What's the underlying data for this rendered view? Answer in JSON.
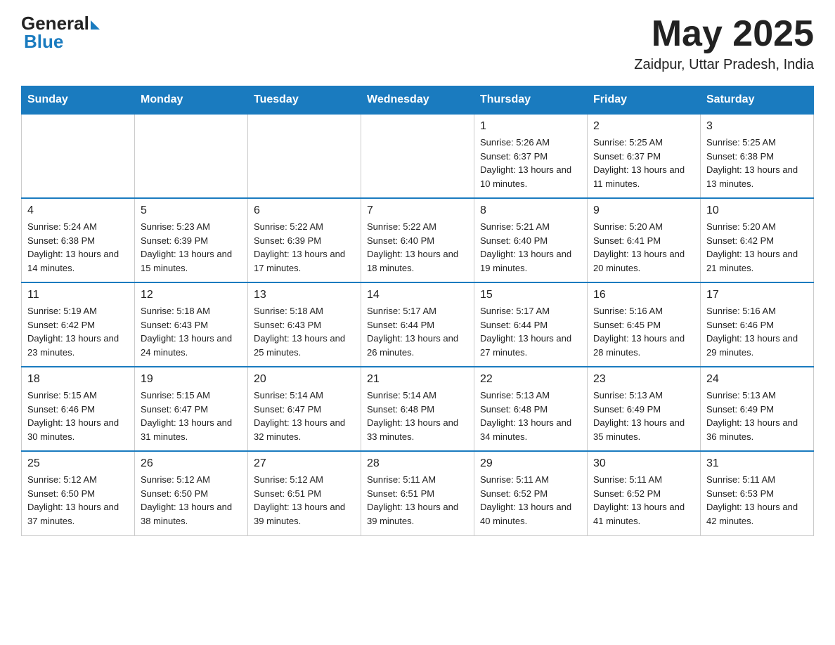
{
  "header": {
    "logo_general": "General",
    "logo_blue": "Blue",
    "month_title": "May 2025",
    "location": "Zaidpur, Uttar Pradesh, India"
  },
  "days_of_week": [
    "Sunday",
    "Monday",
    "Tuesday",
    "Wednesday",
    "Thursday",
    "Friday",
    "Saturday"
  ],
  "weeks": [
    [
      {
        "day": "",
        "info": ""
      },
      {
        "day": "",
        "info": ""
      },
      {
        "day": "",
        "info": ""
      },
      {
        "day": "",
        "info": ""
      },
      {
        "day": "1",
        "info": "Sunrise: 5:26 AM\nSunset: 6:37 PM\nDaylight: 13 hours and 10 minutes."
      },
      {
        "day": "2",
        "info": "Sunrise: 5:25 AM\nSunset: 6:37 PM\nDaylight: 13 hours and 11 minutes."
      },
      {
        "day": "3",
        "info": "Sunrise: 5:25 AM\nSunset: 6:38 PM\nDaylight: 13 hours and 13 minutes."
      }
    ],
    [
      {
        "day": "4",
        "info": "Sunrise: 5:24 AM\nSunset: 6:38 PM\nDaylight: 13 hours and 14 minutes."
      },
      {
        "day": "5",
        "info": "Sunrise: 5:23 AM\nSunset: 6:39 PM\nDaylight: 13 hours and 15 minutes."
      },
      {
        "day": "6",
        "info": "Sunrise: 5:22 AM\nSunset: 6:39 PM\nDaylight: 13 hours and 17 minutes."
      },
      {
        "day": "7",
        "info": "Sunrise: 5:22 AM\nSunset: 6:40 PM\nDaylight: 13 hours and 18 minutes."
      },
      {
        "day": "8",
        "info": "Sunrise: 5:21 AM\nSunset: 6:40 PM\nDaylight: 13 hours and 19 minutes."
      },
      {
        "day": "9",
        "info": "Sunrise: 5:20 AM\nSunset: 6:41 PM\nDaylight: 13 hours and 20 minutes."
      },
      {
        "day": "10",
        "info": "Sunrise: 5:20 AM\nSunset: 6:42 PM\nDaylight: 13 hours and 21 minutes."
      }
    ],
    [
      {
        "day": "11",
        "info": "Sunrise: 5:19 AM\nSunset: 6:42 PM\nDaylight: 13 hours and 23 minutes."
      },
      {
        "day": "12",
        "info": "Sunrise: 5:18 AM\nSunset: 6:43 PM\nDaylight: 13 hours and 24 minutes."
      },
      {
        "day": "13",
        "info": "Sunrise: 5:18 AM\nSunset: 6:43 PM\nDaylight: 13 hours and 25 minutes."
      },
      {
        "day": "14",
        "info": "Sunrise: 5:17 AM\nSunset: 6:44 PM\nDaylight: 13 hours and 26 minutes."
      },
      {
        "day": "15",
        "info": "Sunrise: 5:17 AM\nSunset: 6:44 PM\nDaylight: 13 hours and 27 minutes."
      },
      {
        "day": "16",
        "info": "Sunrise: 5:16 AM\nSunset: 6:45 PM\nDaylight: 13 hours and 28 minutes."
      },
      {
        "day": "17",
        "info": "Sunrise: 5:16 AM\nSunset: 6:46 PM\nDaylight: 13 hours and 29 minutes."
      }
    ],
    [
      {
        "day": "18",
        "info": "Sunrise: 5:15 AM\nSunset: 6:46 PM\nDaylight: 13 hours and 30 minutes."
      },
      {
        "day": "19",
        "info": "Sunrise: 5:15 AM\nSunset: 6:47 PM\nDaylight: 13 hours and 31 minutes."
      },
      {
        "day": "20",
        "info": "Sunrise: 5:14 AM\nSunset: 6:47 PM\nDaylight: 13 hours and 32 minutes."
      },
      {
        "day": "21",
        "info": "Sunrise: 5:14 AM\nSunset: 6:48 PM\nDaylight: 13 hours and 33 minutes."
      },
      {
        "day": "22",
        "info": "Sunrise: 5:13 AM\nSunset: 6:48 PM\nDaylight: 13 hours and 34 minutes."
      },
      {
        "day": "23",
        "info": "Sunrise: 5:13 AM\nSunset: 6:49 PM\nDaylight: 13 hours and 35 minutes."
      },
      {
        "day": "24",
        "info": "Sunrise: 5:13 AM\nSunset: 6:49 PM\nDaylight: 13 hours and 36 minutes."
      }
    ],
    [
      {
        "day": "25",
        "info": "Sunrise: 5:12 AM\nSunset: 6:50 PM\nDaylight: 13 hours and 37 minutes."
      },
      {
        "day": "26",
        "info": "Sunrise: 5:12 AM\nSunset: 6:50 PM\nDaylight: 13 hours and 38 minutes."
      },
      {
        "day": "27",
        "info": "Sunrise: 5:12 AM\nSunset: 6:51 PM\nDaylight: 13 hours and 39 minutes."
      },
      {
        "day": "28",
        "info": "Sunrise: 5:11 AM\nSunset: 6:51 PM\nDaylight: 13 hours and 39 minutes."
      },
      {
        "day": "29",
        "info": "Sunrise: 5:11 AM\nSunset: 6:52 PM\nDaylight: 13 hours and 40 minutes."
      },
      {
        "day": "30",
        "info": "Sunrise: 5:11 AM\nSunset: 6:52 PM\nDaylight: 13 hours and 41 minutes."
      },
      {
        "day": "31",
        "info": "Sunrise: 5:11 AM\nSunset: 6:53 PM\nDaylight: 13 hours and 42 minutes."
      }
    ]
  ]
}
